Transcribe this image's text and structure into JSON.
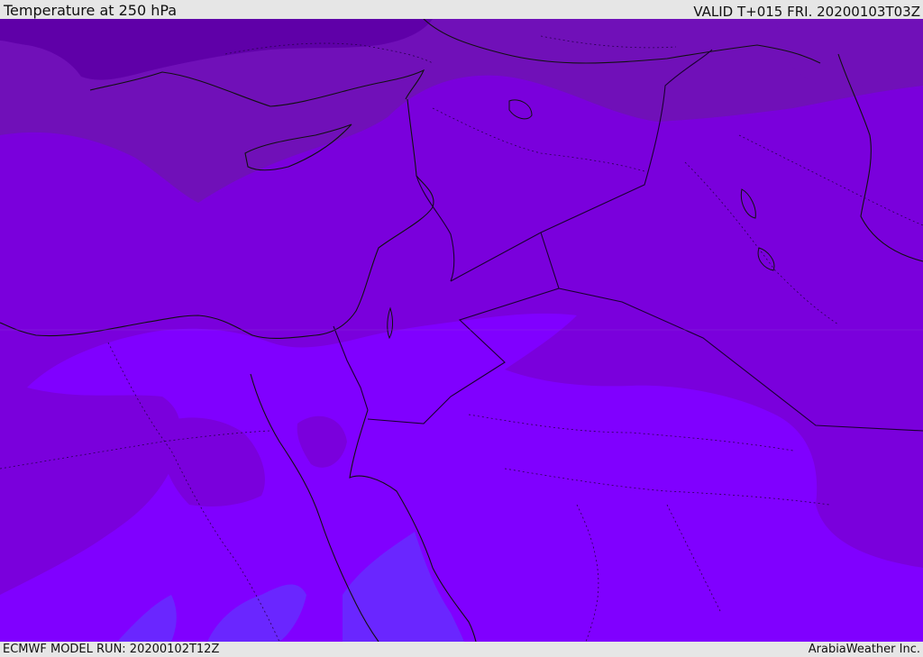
{
  "header": {
    "title": "Temperature at 250 hPa",
    "valid_time": "VALID T+015 FRI. 20200103T03Z"
  },
  "footer": {
    "model_run": "ECMWF MODEL RUN: 20200102T12Z",
    "credit": "ArabiaWeather Inc."
  },
  "map": {
    "field": "temperature",
    "level": "250 hPa",
    "colors": {
      "darkest": "#5f00a8",
      "dark": "#7010b8",
      "mid": "#7a00dc",
      "light": "#8000ff",
      "lightest": "#6a26ff",
      "coast": "#111111",
      "border": "#1a0030"
    }
  }
}
